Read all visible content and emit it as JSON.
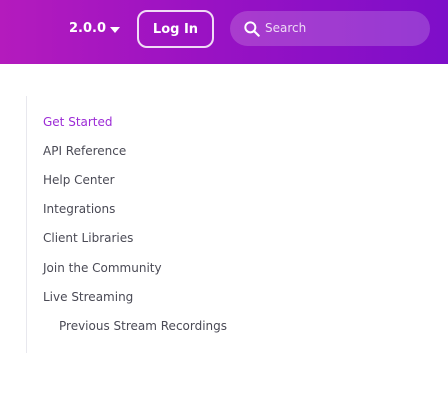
{
  "header": {
    "version": "2.0.0",
    "login_label": "Log In",
    "search_placeholder": "Search",
    "gradient_start": "#b41bbd",
    "gradient_end": "#7e0ec9"
  },
  "sidebar": {
    "active_color": "#9c2bd6",
    "items": [
      {
        "label": "Get Started",
        "active": true
      },
      {
        "label": "API Reference"
      },
      {
        "label": "Help Center"
      },
      {
        "label": "Integrations"
      },
      {
        "label": "Client Libraries"
      },
      {
        "label": "Join the Community"
      },
      {
        "label": "Live Streaming"
      },
      {
        "label": "Previous Stream Recordings",
        "sub": true
      }
    ]
  }
}
